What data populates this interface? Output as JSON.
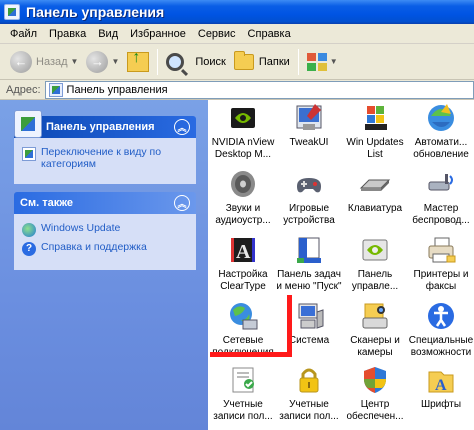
{
  "window": {
    "title": "Панель управления"
  },
  "menu": [
    "Файл",
    "Правка",
    "Вид",
    "Избранное",
    "Сервис",
    "Справка"
  ],
  "toolbar": {
    "back_label": "Назад",
    "search_label": "Поиск",
    "folders_label": "Папки"
  },
  "address": {
    "label": "Адрес:",
    "value": "Панель управления"
  },
  "left_panel": {
    "control_panel": {
      "title": "Панель управления",
      "link": "Переключение к виду по категориям"
    },
    "see_also": {
      "title": "См. также",
      "links": [
        "Windows Update",
        "Справка и поддержка"
      ]
    }
  },
  "items": [
    {
      "label": "NVIDIA nView Desktop M...",
      "icon": "nvidia-icon"
    },
    {
      "label": "TweakUI",
      "icon": "tweakui-icon"
    },
    {
      "label": "Win Updates List",
      "icon": "win-updates-icon"
    },
    {
      "label": "Автомати... обновление",
      "icon": "auto-update-icon"
    },
    {
      "label": "Звуки и аудиоустр...",
      "icon": "speaker-icon"
    },
    {
      "label": "Игровые устройства",
      "icon": "gamepad-icon"
    },
    {
      "label": "Клавиатура",
      "icon": "keyboard-icon"
    },
    {
      "label": "Мастер беспровод...",
      "icon": "wireless-icon"
    },
    {
      "label": "Настройка ClearType",
      "icon": "cleartype-icon"
    },
    {
      "label": "Панель задач и меню \"Пуск\"",
      "icon": "taskbar-icon"
    },
    {
      "label": "Панель управле...",
      "icon": "nvidia-panel-icon"
    },
    {
      "label": "Принтеры и факсы",
      "icon": "printer-icon"
    },
    {
      "label": "Сетевые подключения",
      "icon": "network-icon"
    },
    {
      "label": "Система",
      "icon": "system-icon"
    },
    {
      "label": "Сканеры и камеры",
      "icon": "scanner-icon"
    },
    {
      "label": "Специальные возможности",
      "icon": "accessibility-icon"
    },
    {
      "label": "Учетные записи пол...",
      "icon": "user-accounts-icon"
    },
    {
      "label": "Учетные записи пол...",
      "icon": "user-accounts-lock-icon"
    },
    {
      "label": "Центр обеспечен...",
      "icon": "security-center-icon"
    },
    {
      "label": "Шрифты",
      "icon": "fonts-icon"
    }
  ],
  "colors": {
    "titlebar": "#0054e3",
    "leftpane": "#6b8fe0",
    "link": "#215dc6",
    "annotation": "#ff1a1a"
  }
}
